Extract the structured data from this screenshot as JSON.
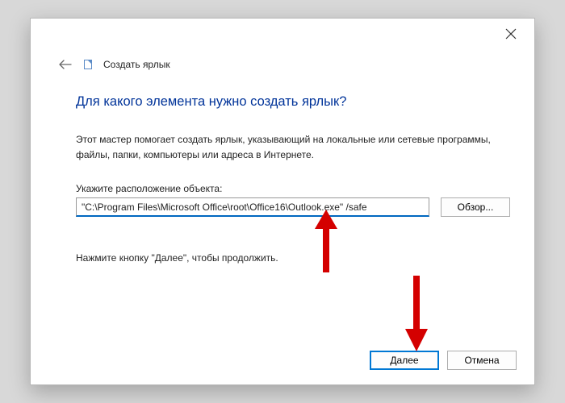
{
  "window": {
    "title": "Создать ярлык",
    "close_label": "Close"
  },
  "heading": "Для какого элемента нужно создать ярлык?",
  "description": "Этот мастер помогает создать ярлык, указывающий на локальные или сетевые программы, файлы, папки, компьютеры или адреса в Интернете.",
  "field": {
    "label": "Укажите расположение объекта:",
    "value": "\"C:\\Program Files\\Microsoft Office\\root\\Office16\\Outlook.exe\" /safe"
  },
  "buttons": {
    "browse": "Обзор...",
    "next": "Далее",
    "cancel": "Отмена"
  },
  "continue_hint": "Нажмите кнопку \"Далее\", чтобы продолжить."
}
